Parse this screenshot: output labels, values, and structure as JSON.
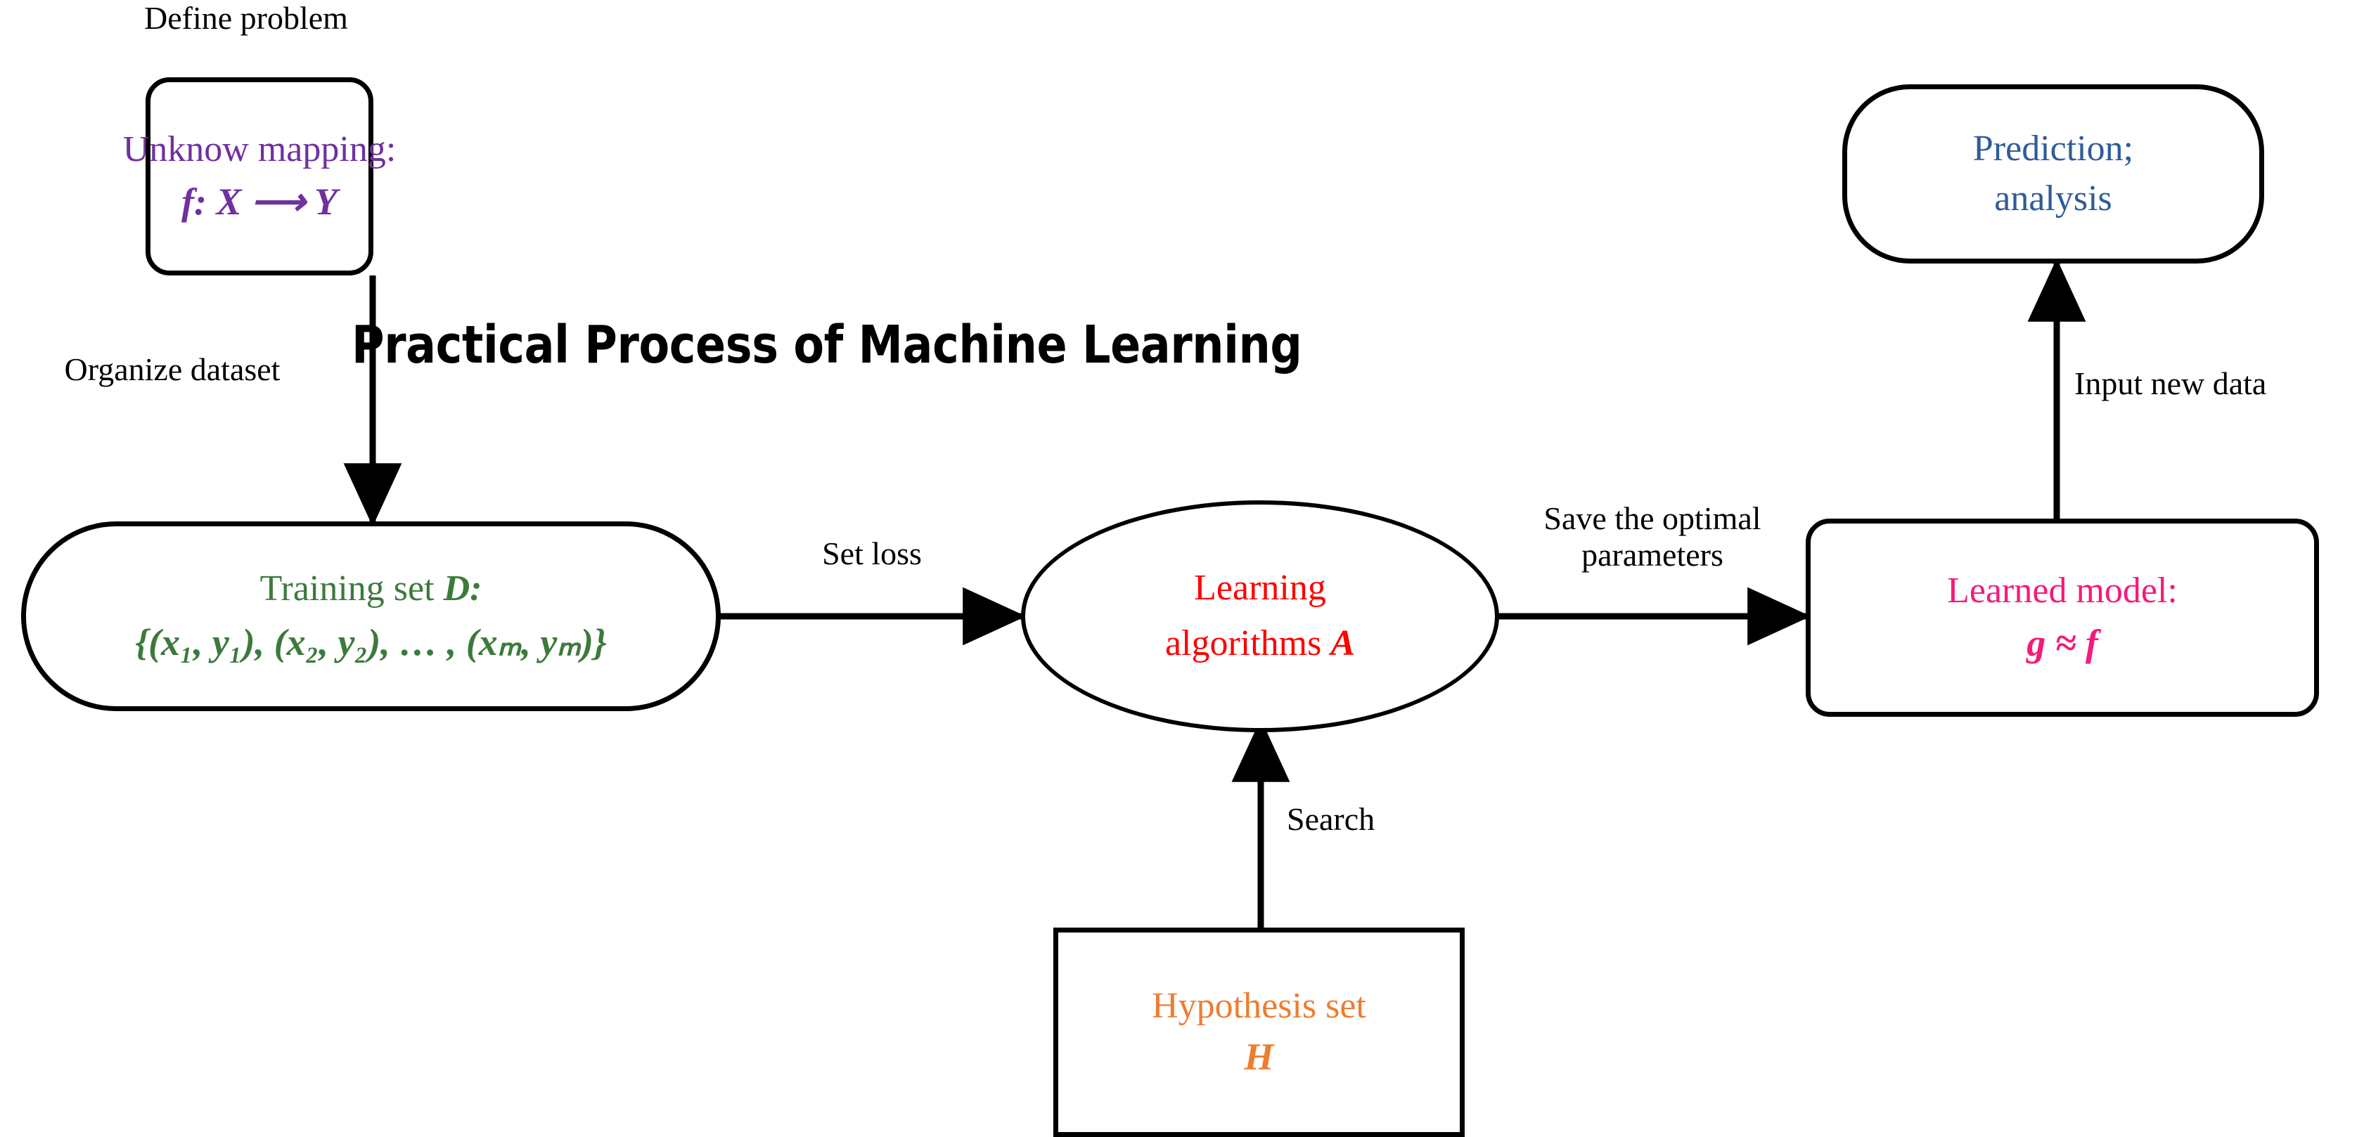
{
  "title": "Practical Process of Machine Learning",
  "colors": {
    "unknown_mapping": "#7030A0",
    "training_set": "#3C7A3C",
    "learning_algorithms": "#FF0000",
    "learned_model": "#F51A7B",
    "prediction": "#2E5C9A",
    "hypothesis_set": "#ED7D31",
    "stroke": "#000000",
    "background": "#FFFFFF"
  },
  "nodes": {
    "unknown_mapping": {
      "name": "unknow-mapping",
      "shape": "rounded-rectangle",
      "line1": "Unknow mapping:",
      "line2": "f: X ⟶ Y"
    },
    "training_set": {
      "name": "training-set",
      "shape": "stadium",
      "line1_prefix": "Training set ",
      "line1_symbol": "D:",
      "line2": "{(x₁, y₁), (x₂, y₂), … , (xₘ, yₘ)}"
    },
    "learning_algorithms": {
      "name": "learning-algorithms",
      "shape": "ellipse",
      "line1": "Learning",
      "line2_prefix": "algorithms ",
      "line2_symbol": "A"
    },
    "learned_model": {
      "name": "learned-model",
      "shape": "rounded-rectangle",
      "line1": "Learned model:",
      "line2": "g ≈ f"
    },
    "prediction": {
      "name": "prediction-analysis",
      "shape": "rounded-rectangle-large",
      "line1": "Prediction;",
      "line2": "analysis"
    },
    "hypothesis_set": {
      "name": "hypothesis-set",
      "shape": "rectangle",
      "line1": "Hypothesis set",
      "line2": "H"
    }
  },
  "edges": {
    "define_problem": "Define problem",
    "organize_dataset": "Organize dataset",
    "set_loss": "Set loss",
    "save_optimal_line1": "Save the optimal",
    "save_optimal_line2": "parameters",
    "input_new_data": "Input new data",
    "search": "Search"
  }
}
